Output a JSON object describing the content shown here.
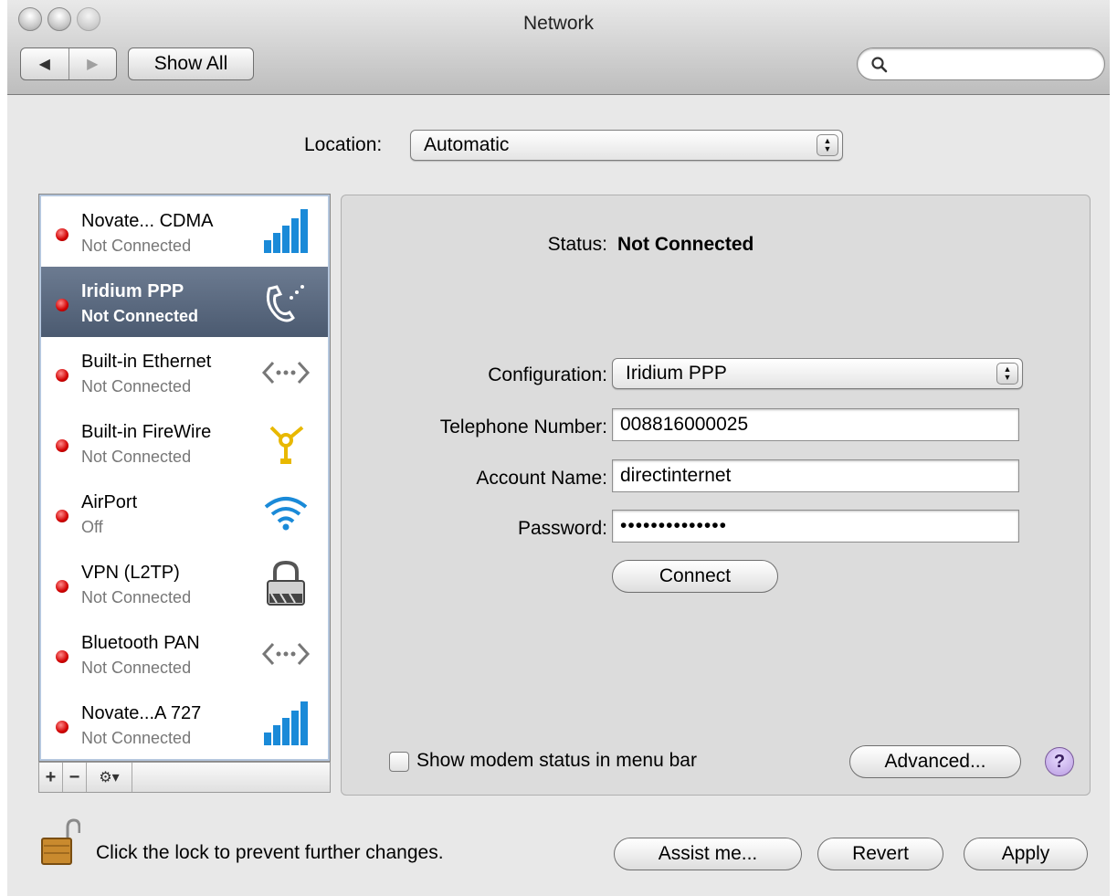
{
  "window": {
    "title": "Network"
  },
  "toolbar": {
    "back_glyph": "◀",
    "forward_glyph": "▶",
    "show_all_label": "Show All",
    "search_placeholder": ""
  },
  "location": {
    "label": "Location:",
    "value": "Automatic"
  },
  "services": [
    {
      "name": "Novate... CDMA",
      "status": "Not Connected",
      "icon": "cellular-signal-icon",
      "selected": false
    },
    {
      "name": "Iridium PPP",
      "status": "Not Connected",
      "icon": "telephone-modem-icon",
      "selected": true
    },
    {
      "name": "Built-in Ethernet",
      "status": "Not Connected",
      "icon": "ethernet-arrows-icon",
      "selected": false
    },
    {
      "name": "Built-in FireWire",
      "status": "Not Connected",
      "icon": "firewire-icon",
      "selected": false
    },
    {
      "name": "AirPort",
      "status": "Off",
      "icon": "wifi-icon",
      "selected": false
    },
    {
      "name": "VPN (L2TP)",
      "status": "Not Connected",
      "icon": "vpn-lock-icon",
      "selected": false
    },
    {
      "name": "Bluetooth PAN",
      "status": "Not Connected",
      "icon": "ethernet-arrows-icon",
      "selected": false
    },
    {
      "name": "Novate...A 727",
      "status": "Not Connected",
      "icon": "cellular-signal-icon",
      "selected": false
    }
  ],
  "list_actions": {
    "add": "+",
    "remove": "−",
    "gear": "⚙▾"
  },
  "detail": {
    "status_label": "Status:",
    "status_value": "Not Connected",
    "configuration_label": "Configuration:",
    "configuration_value": "Iridium PPP",
    "telephone_label": "Telephone Number:",
    "telephone_value": "008816000025",
    "account_label": "Account Name:",
    "account_value": "directinternet",
    "password_label": "Password:",
    "password_value": "••••••••••••••",
    "connect_label": "Connect",
    "modem_status_label": "Show modem status in menu bar",
    "modem_status_checked": false,
    "advanced_label": "Advanced...",
    "help_label": "?"
  },
  "footer": {
    "lock_text": "Click the lock to prevent further changes.",
    "assist_label": "Assist me...",
    "revert_label": "Revert",
    "apply_label": "Apply"
  },
  "colors": {
    "status_dot": "#d10000",
    "selection": "#5a6980",
    "signal_blue": "#1a8ad8"
  }
}
